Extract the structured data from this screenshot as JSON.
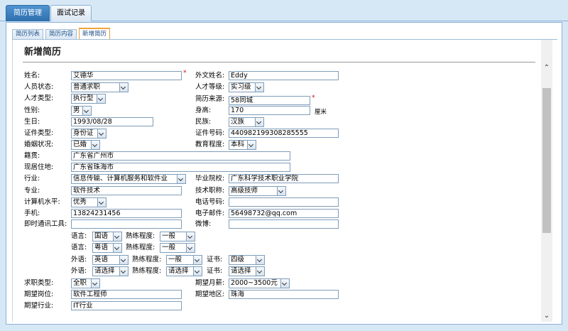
{
  "top_tabs": [
    "简历管理",
    "面试记录"
  ],
  "sub_tabs": [
    "简历列表",
    "简历内容",
    "新增简历"
  ],
  "page_title": "新增简历",
  "required_mark": "*",
  "fields": {
    "name": {
      "label": "姓名:",
      "value": "艾德华"
    },
    "english_name": {
      "label": "外文姓名:",
      "value": "Eddy"
    },
    "status": {
      "label": "人员状态:",
      "value": "普通求职"
    },
    "talent_level": {
      "label": "人才等级:",
      "value": "实习级"
    },
    "talent_type": {
      "label": "人才类型:",
      "value": "执行型"
    },
    "source": {
      "label": "简历来源:",
      "value": "58同城"
    },
    "gender": {
      "label": "性别:",
      "value": "男"
    },
    "height": {
      "label": "身高:",
      "value": "170",
      "unit": "厘米"
    },
    "birthday": {
      "label": "生日:",
      "value": "1993/08/28"
    },
    "ethnicity": {
      "label": "民族:",
      "value": "汉族"
    },
    "id_type": {
      "label": "证件类型:",
      "value": "身份证"
    },
    "id_number": {
      "label": "证件号码:",
      "value": "440982199308285555"
    },
    "marital": {
      "label": "婚姻状况:",
      "value": "已婚"
    },
    "education": {
      "label": "教育程度:",
      "value": "本科"
    },
    "native_place": {
      "label": "籍贯:",
      "value": "广东省广州市"
    },
    "residence": {
      "label": "现居住地:",
      "value": "广东省珠海市"
    },
    "industry": {
      "label": "行业:",
      "value": "信息传输、计算机服务和软件业"
    },
    "school": {
      "label": "毕业院校:",
      "value": "广东科学技术职业学院"
    },
    "major": {
      "label": "专业:",
      "value": "软件技术"
    },
    "tech_title": {
      "label": "技术职称:",
      "value": "高级技师"
    },
    "computer_level": {
      "label": "计算机水平:",
      "value": "优秀"
    },
    "phone": {
      "label": "电话号码:",
      "value": ""
    },
    "mobile": {
      "label": "手机:",
      "value": "13824231456"
    },
    "email": {
      "label": "电子邮件:",
      "value": "56498732@qq.com"
    },
    "im_tool": {
      "label": "即时通讯工具:",
      "value": ""
    },
    "weibo": {
      "label": "微博:",
      "value": ""
    },
    "job_type": {
      "label": "求职类型:",
      "value": "全职"
    },
    "expected_salary": {
      "label": "期望月薪:",
      "value": "2000~3500元"
    },
    "expected_position": {
      "label": "期望岗位:",
      "value": "软件工程师"
    },
    "expected_region": {
      "label": "期望地区:",
      "value": "珠海"
    },
    "expected_industry": {
      "label": "期望行业:",
      "value": "IT行业"
    }
  },
  "languages": [
    {
      "lang_label": "语言:",
      "lang": "国语",
      "prof_label": "熟练程度:",
      "prof": "一般"
    },
    {
      "lang_label": "语言:",
      "lang": "粤语",
      "prof_label": "熟练程度:",
      "prof": "一般"
    }
  ],
  "foreign_languages": [
    {
      "lang_label": "外语:",
      "lang": "英语",
      "prof_label": "熟练程度:",
      "prof": "一般",
      "cert_label": "证书:",
      "cert": "四级"
    },
    {
      "lang_label": "外语:",
      "lang": "请选择",
      "prof_label": "熟练程度:",
      "prof": "请选择",
      "cert_label": "证书:",
      "cert": "请选择"
    }
  ]
}
